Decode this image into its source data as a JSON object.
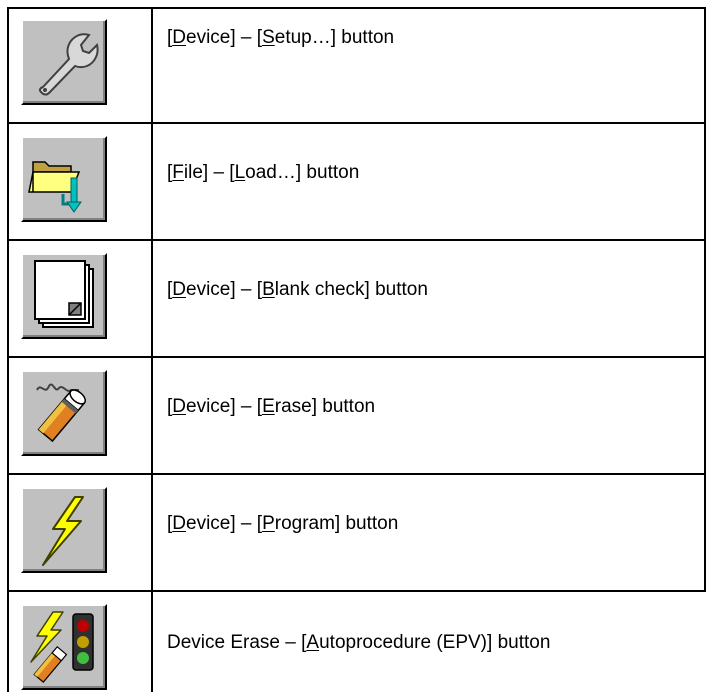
{
  "rows": [
    {
      "icon": "wrench-icon",
      "parts": [
        "[",
        "D",
        "evice] –  [",
        "S",
        "etup…] button"
      ]
    },
    {
      "icon": "open-folder-load-icon",
      "parts": [
        "[",
        "F",
        "ile] – [",
        "L",
        "oad…] button"
      ]
    },
    {
      "icon": "blank-pages-icon",
      "parts": [
        "[",
        "D",
        "evice] – [",
        "B",
        "lank check] button"
      ]
    },
    {
      "icon": "eraser-pencil-icon",
      "parts": [
        "[",
        "D",
        "evice] – [",
        "E",
        "rase] button"
      ]
    },
    {
      "icon": "lightning-bolt-icon",
      "parts": [
        "[",
        "D",
        "evice] – [",
        "P",
        "rogram] button"
      ]
    },
    {
      "icon": "autoprocedure-icon",
      "parts": [
        "Device Erase – [",
        "A",
        "utoprocedure (EPV)] button"
      ]
    }
  ],
  "colors": {
    "button_face": "#c0c0c0",
    "folder_yellow": "#ffff80",
    "arrow_cyan": "#00c0c0",
    "bolt_yellow": "#ffff00"
  }
}
